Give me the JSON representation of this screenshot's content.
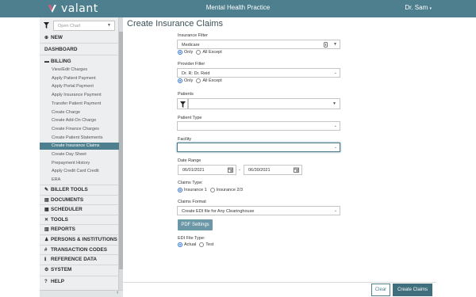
{
  "header": {
    "logo_text": "valant",
    "app_title": "Mental Health Practice",
    "user": "Dr. Sam"
  },
  "sidebar": {
    "search_placeholder": "Open Chart",
    "new_label": "NEW",
    "dashboard_label": "DASHBOARD",
    "billing_label": "BILLING",
    "billing_items": [
      "View/Edit Charges",
      "Apply Patient Payment",
      "Apply Portal Payment",
      "Apply Insurance Payment",
      "Transfer Patient Payment",
      "Create Charge",
      "Create Add-On Charge",
      "Create Finance Charges",
      "Create Patient Statements",
      "Create Insurance Claims",
      "Create Day Sheet",
      "Prepayment History",
      "Apply Credit Card Credit",
      "ERA"
    ],
    "active_item": "Create Insurance Claims",
    "sections": [
      "BILLER TOOLS",
      "DOCUMENTS",
      "SCHEDULER",
      "TOOLS",
      "REPORTS",
      "PERSONS & INSTITUTIONS",
      "TRANSACTION CODES",
      "REFERENCE DATA",
      "SYSTEM"
    ],
    "help_label": "HELP"
  },
  "form": {
    "title": "Create Insurance Claims",
    "insurance_filter": {
      "label": "Insurance Filter",
      "value": "Medicare",
      "opt_only": "Only",
      "opt_except": "All Except"
    },
    "provider_filter": {
      "label": "Provider Filter",
      "value": "Dr. R: Dr. Reid",
      "opt_only": "Only",
      "opt_except": "All Except"
    },
    "patients": {
      "label": "Patients",
      "value": ""
    },
    "patient_type": {
      "label": "Patient Type",
      "value": ""
    },
    "facility": {
      "label": "Facility",
      "value": ""
    },
    "date_range": {
      "label": "Date Range",
      "start": "06/01/2021",
      "separator": "-",
      "end": "06/30/2021"
    },
    "claims_type": {
      "label": "Claims Type:",
      "opt1": "Insurance 1",
      "opt2": "Insurance 2/3"
    },
    "claims_format": {
      "label": "Claims Format",
      "value": "Create EDI file for Any Clearinghouse"
    },
    "pdf_button": "PDF Settings",
    "edi_file_type": {
      "label": "EDI File Type:",
      "opt1": "Actual",
      "opt2": "Test"
    }
  },
  "footer": {
    "clear_label": "Clear",
    "create_label": "Create Claims"
  },
  "colors": {
    "brand": "#4e7f8e",
    "primary_button": "#3f6e7d",
    "radio_selected": "#2a6fdb"
  },
  "icons": [
    "valant-logo-icon",
    "filter-icon",
    "plus-circle-icon",
    "credit-card-icon",
    "calendar-icon",
    "paperclip-icon",
    "chevron-down-icon",
    "chevron-left-icon",
    "help-icon"
  ]
}
